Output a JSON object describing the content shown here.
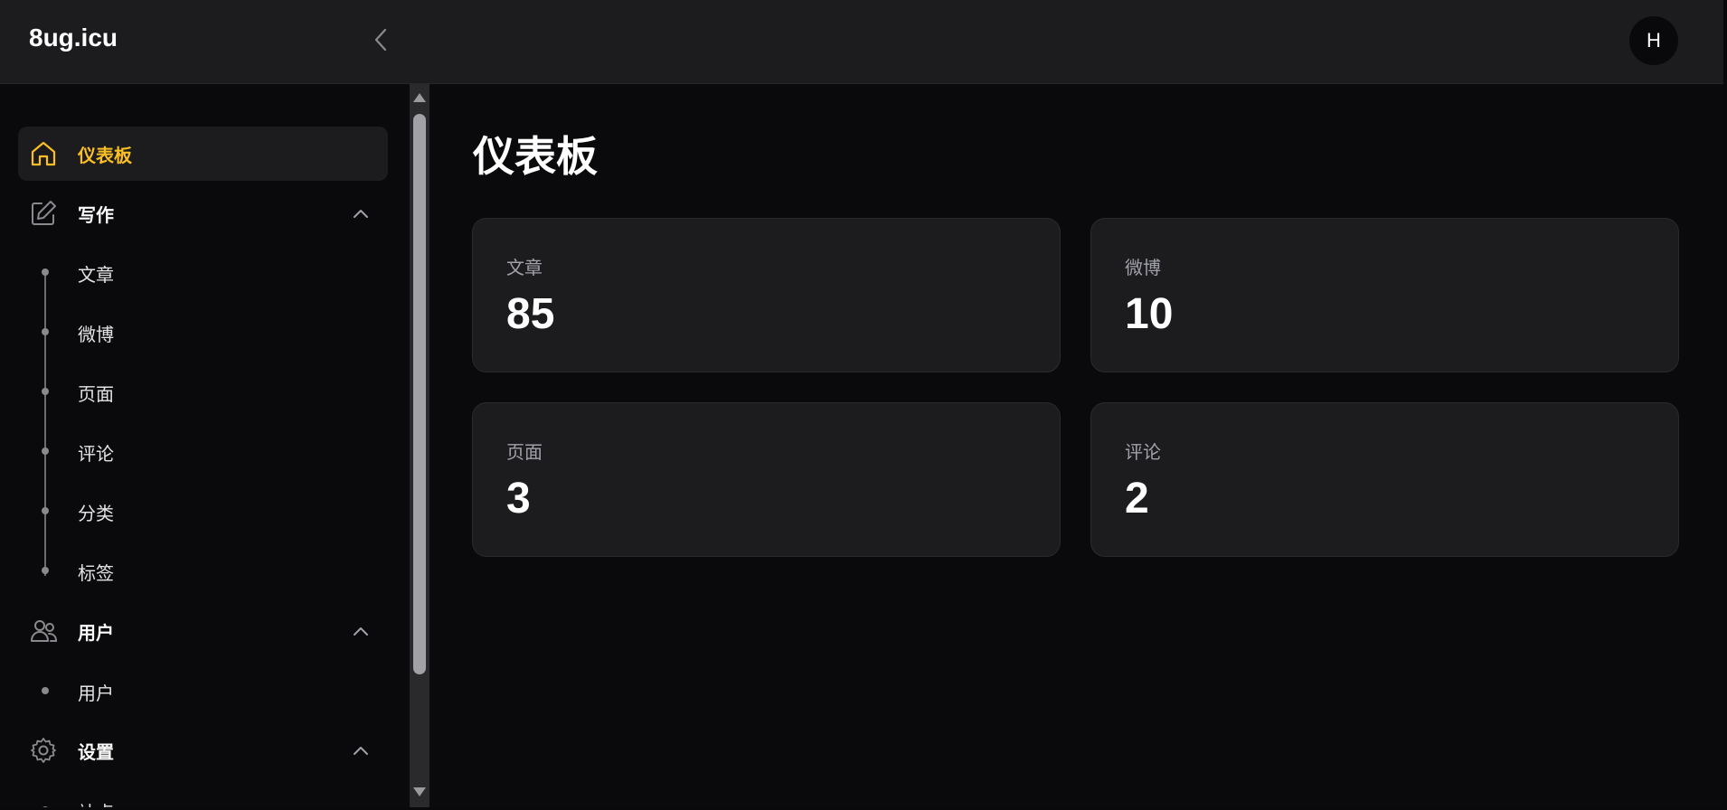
{
  "header": {
    "brand": "8ug.icu",
    "avatar_initial": "H"
  },
  "sidebar": {
    "dashboard": {
      "label": "仪表板",
      "icon": "home-icon"
    },
    "writing": {
      "label": "写作",
      "icon": "edit-icon",
      "items": [
        {
          "label": "文章"
        },
        {
          "label": "微博"
        },
        {
          "label": "页面"
        },
        {
          "label": "评论"
        },
        {
          "label": "分类"
        },
        {
          "label": "标签"
        }
      ]
    },
    "users": {
      "label": "用户",
      "icon": "users-icon",
      "items": [
        {
          "label": "用户"
        }
      ]
    },
    "settings": {
      "label": "设置",
      "icon": "gear-icon",
      "items": [
        {
          "label": "站点"
        }
      ]
    }
  },
  "main": {
    "title": "仪表板",
    "stats": [
      {
        "label": "文章",
        "value": "85"
      },
      {
        "label": "微博",
        "value": "10"
      },
      {
        "label": "页面",
        "value": "3"
      },
      {
        "label": "评论",
        "value": "2"
      }
    ]
  },
  "colors": {
    "accent": "#fbbf24",
    "background": "#0a0a0c",
    "card": "#1c1c1f"
  }
}
